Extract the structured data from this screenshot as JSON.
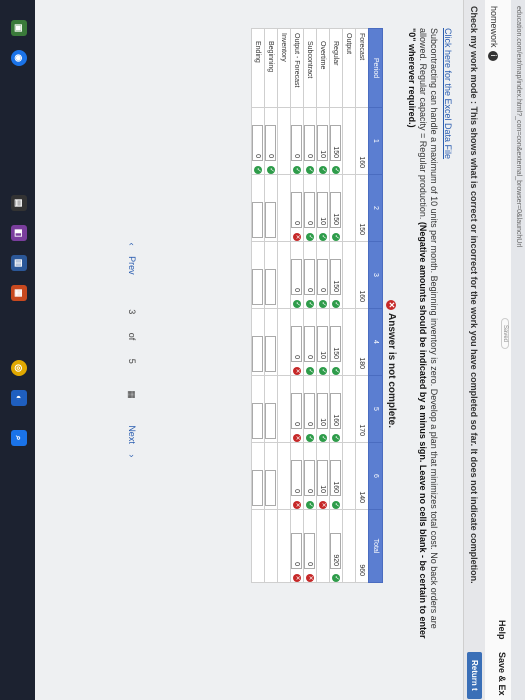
{
  "browser": {
    "url": "education.com/ext/map/index.html?_con=con&external_browser=0&launchUrl"
  },
  "header": {
    "saved_label": "Saved",
    "title": "homework",
    "help_label": "Help",
    "save_exit_label": "Save & Ex"
  },
  "mode_bar": {
    "text": "Check my work mode : This shows what is correct or incorrect for the work you have completed so far. It does not indicate completion.",
    "return_label": "Return t"
  },
  "problem": {
    "excel_link": "Click here for the Excel Data File",
    "instruction_1": "Subcontracting can handle a maximum of 10 units per month. Beginning inventory is zero. Develop a plan that minimizes total cost. No back orders are allowed. Regular capacity = Regular production.",
    "instruction_bold": "(Negative amounts should be indicated by a minus sign. Leave no cells blank - be certain to enter \"0\" wherever required.)"
  },
  "status": {
    "text": "Answer is not complete."
  },
  "table": {
    "headers": [
      "Period",
      "1",
      "2",
      "3",
      "4",
      "5",
      "6",
      "Total"
    ],
    "forecast": {
      "label": "Forecast",
      "values": [
        "160",
        "150",
        "160",
        "180",
        "170",
        "140"
      ],
      "total": "960"
    },
    "output_label": "Output",
    "regular": {
      "label": "Regular",
      "values": [
        "150",
        "150",
        "150",
        "150",
        "160",
        "160"
      ],
      "total": "920"
    },
    "overtime": {
      "label": "Overtime",
      "values": [
        "10",
        "10",
        "0",
        "10",
        "10",
        "10"
      ]
    },
    "subcontract": {
      "label": "Subcontract",
      "values": [
        "0",
        "0",
        "0",
        "0",
        "0",
        "0"
      ],
      "total": "0"
    },
    "output_forecast": {
      "label": "Output - Forecast",
      "values": [
        "0",
        "0",
        "0",
        "0",
        "0",
        "0"
      ],
      "total": "0"
    },
    "inventory_label": "Inventory",
    "beginning": {
      "label": "Beginning",
      "values": [
        "0",
        "",
        "",
        "",
        "",
        ""
      ]
    },
    "ending": {
      "label": "Ending",
      "values": [
        "0",
        "",
        "",
        "",
        "",
        ""
      ]
    }
  },
  "pager": {
    "prev": "Prev",
    "current": "3",
    "of_label": "of",
    "total": "5",
    "next": "Next"
  }
}
